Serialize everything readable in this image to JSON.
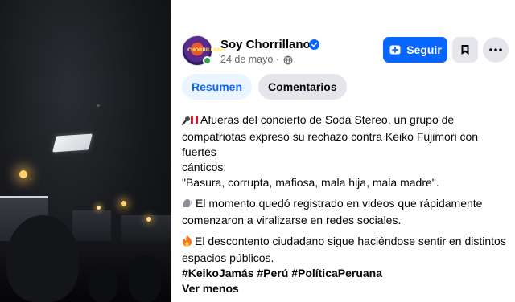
{
  "post": {
    "author": "Soy Chorrillano",
    "avatar_text": "CHORRILLANO",
    "date": "24 de mayo",
    "follow_label": "Seguir",
    "tabs": [
      {
        "label": "Resumen",
        "active": true
      },
      {
        "label": "Comentarios",
        "active": false
      }
    ],
    "paragraphs": [
      {
        "icon": "microphone-peru-flag",
        "lines": [
          "Afueras del concierto de Soda Stereo, un grupo de",
          "compatriotas expresó su rechazo contra Keiko Fujimori con fuertes",
          "cánticos:",
          "\"Basura, corrupta, mafiosa, mala hija, mala madre\"."
        ]
      },
      {
        "icon": "speaking-head",
        "lines": [
          "El momento quedó registrado en videos que rápidamente",
          "comenzaron a viralizarse en redes sociales."
        ]
      },
      {
        "icon": "fire",
        "lines": [
          "El descontento ciudadano sigue haciéndose sentir en distintos",
          "espacios públicos."
        ]
      }
    ],
    "hashtags": "#KeikoJamás #Perú #PolíticaPeruana",
    "see_less": "Ver menos"
  },
  "colors": {
    "accent": "#0866ff",
    "tab_active_bg": "#ebf5ff",
    "button_gray": "#e4e6eb",
    "muted_text": "#65676b",
    "online": "#31a24c"
  }
}
